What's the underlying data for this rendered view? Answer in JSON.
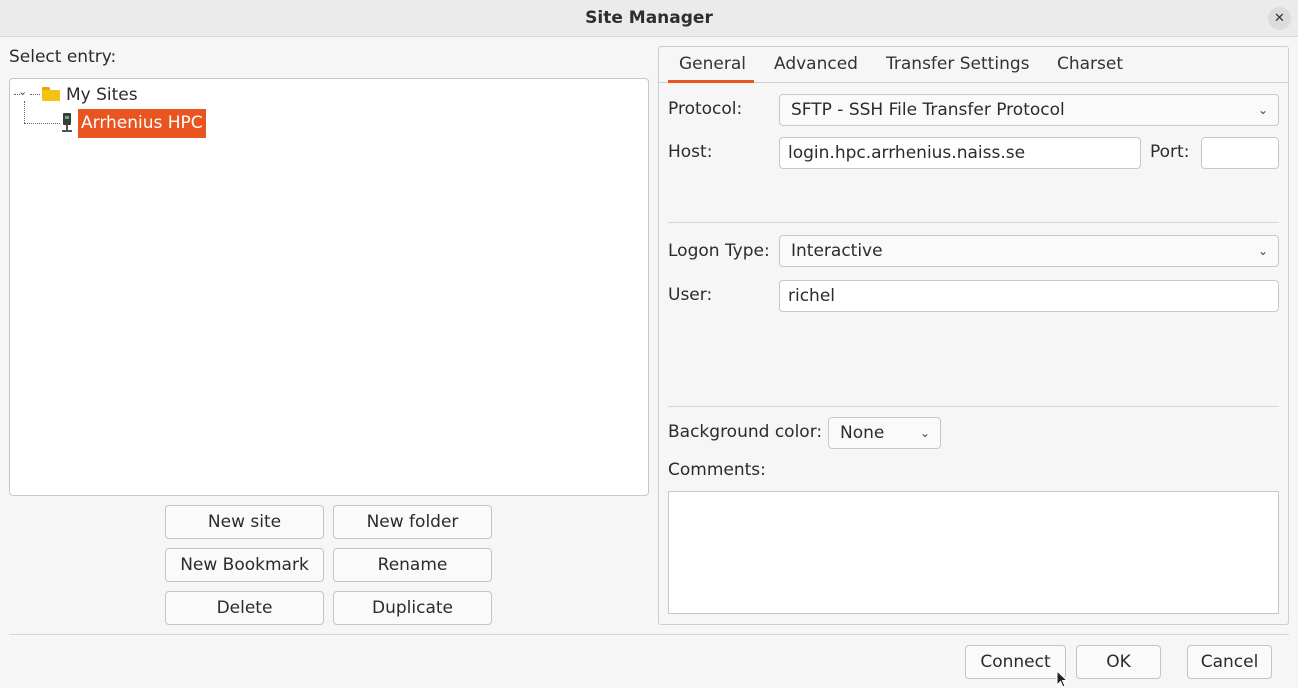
{
  "window": {
    "title": "Site Manager",
    "close_icon": "✕"
  },
  "left": {
    "select_label": "Select entry:",
    "tree": {
      "folder": {
        "label": "My Sites",
        "icon": "folder-icon"
      },
      "site": {
        "label": "Arrhenius HPC",
        "icon": "server-icon",
        "selected": true
      }
    },
    "buttons": {
      "new_site": "New site",
      "new_folder": "New folder",
      "new_bookmark": "New Bookmark",
      "rename": "Rename",
      "delete": "Delete",
      "duplicate": "Duplicate"
    }
  },
  "tabs": [
    "General",
    "Advanced",
    "Transfer Settings",
    "Charset"
  ],
  "general": {
    "protocol_label": "Protocol:",
    "protocol_value": "SFTP - SSH File Transfer Protocol",
    "host_label": "Host:",
    "host_value": "login.hpc.arrhenius.naiss.se",
    "port_label": "Port:",
    "port_value": "",
    "logon_type_label": "Logon Type:",
    "logon_type_value": "Interactive",
    "user_label": "User:",
    "user_value": "richel",
    "bg_color_label": "Background color:",
    "bg_color_value": "None",
    "comments_label": "Comments:",
    "comments_value": ""
  },
  "footer": {
    "connect": "Connect",
    "ok": "OK",
    "cancel": "Cancel"
  },
  "colors": {
    "accent": "#e95420",
    "window_bg": "#f6f6f6"
  }
}
